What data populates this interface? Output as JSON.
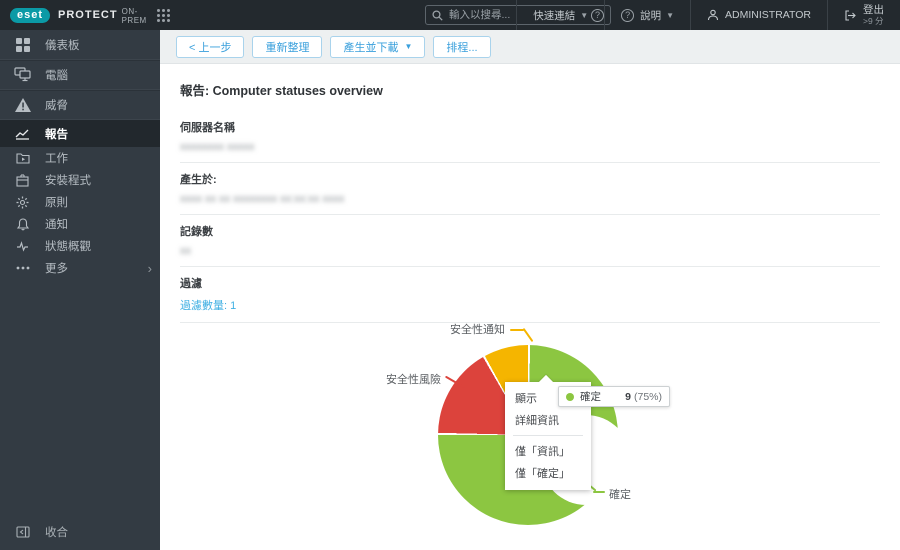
{
  "topbar": {
    "logo_text": "eset",
    "product": "PROTECT",
    "edition": "ON-PREM",
    "search_placeholder": "輸入以搜尋...",
    "quick_links": "快速連結",
    "help": "說明",
    "user": "ADMINISTRATOR",
    "logout_label": "登出",
    "logout_session": ">9 分"
  },
  "sidebar": {
    "items": [
      {
        "label": "儀表板"
      },
      {
        "label": "電腦"
      },
      {
        "label": "威脅"
      },
      {
        "label": "報告"
      },
      {
        "label": "工作"
      },
      {
        "label": "安裝程式"
      },
      {
        "label": "原則"
      },
      {
        "label": "通知"
      },
      {
        "label": "狀態概觀"
      },
      {
        "label": "更多"
      }
    ],
    "collapse": "收合"
  },
  "toolbar": {
    "back": "< 上一步",
    "refresh": "重新整理",
    "generate_download": "產生並下載",
    "schedule": "排程..."
  },
  "report": {
    "title": "報告: Computer statuses overview",
    "fields": [
      {
        "label": "伺服器名稱",
        "value": "xxxxxxxx xxxxx",
        "redacted": true
      },
      {
        "label": "產生於:",
        "value": "xxxx xx xx xxxxxxxx xx:xx:xx xxxx",
        "redacted": true
      },
      {
        "label": "記錄數",
        "value": "xx",
        "redacted": true
      },
      {
        "label": "過濾",
        "link": "過濾數量: 1"
      }
    ]
  },
  "chart_data": {
    "type": "pie",
    "donut": true,
    "title": "Computer statuses overview",
    "series": [
      {
        "name": "確定",
        "value": 9,
        "pct": "75%",
        "color": "#8cc641"
      },
      {
        "name": "安全性風險",
        "value": 2,
        "pct": "17%",
        "color": "#dc433c"
      },
      {
        "name": "安全性通知",
        "value": 1,
        "pct": "8%",
        "color": "#f5b500"
      }
    ],
    "total_records": 12,
    "tooltip": {
      "name": "確定",
      "value": "9",
      "pct": "(75%)"
    },
    "legend_position": "callout-labels"
  },
  "chart_menu": {
    "group1": [
      "顯示",
      "詳細資訊"
    ],
    "group2": [
      "僅「資訊」",
      "僅「確定」"
    ]
  },
  "colors": {
    "topbar_bg": "#23292e",
    "sidebar_bg": "#333b43",
    "selected_bg": "#22282d",
    "accent_blue": "#3aa0dc",
    "link_blue": "#41b0e3",
    "brand_teal": "#0b9aa6"
  }
}
